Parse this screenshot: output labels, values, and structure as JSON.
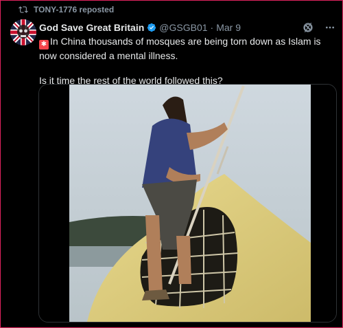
{
  "repost": {
    "label": "TONY-1776 reposted",
    "icon": "repost-icon"
  },
  "author": {
    "name": "God Save Great Britain",
    "handle": "@GSGB01",
    "separator": "·",
    "date": "Mar 9",
    "verified": true
  },
  "tweet": {
    "emoji": "siren-emoji",
    "line1": "In China thousands of mosques are being torn down as Islam is now considered a mental illness.",
    "line2": "Is it time the rest of the world followed this?"
  },
  "media": {
    "type": "video-still"
  },
  "colors": {
    "background": "#000000",
    "text": "#e7e9ea",
    "muted": "#8b98a5",
    "accent_border": "#e0245e",
    "verified": "#1d9bf0"
  }
}
